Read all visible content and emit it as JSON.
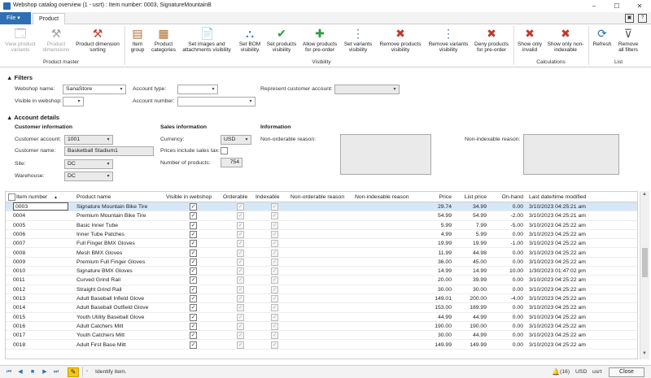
{
  "window": {
    "title": "Webshop catalog overview (1 - usrt) : Item number: 0003, SignatureMountainB",
    "minimize": "–",
    "maximize": "☐",
    "close": "✕"
  },
  "tabs": {
    "file": "File",
    "file_arrow": "▾",
    "product": "Product"
  },
  "ribbon": {
    "groups": {
      "product_master": "Product master",
      "visibility": "Visibility",
      "calculations": "Calculations",
      "list": "List"
    },
    "buttons": [
      {
        "label": "View product variants",
        "icon": "🗔",
        "disabled": true
      },
      {
        "label": "Product dimensions",
        "icon": "⚒",
        "disabled": true
      },
      {
        "label": "Product dimension sorting",
        "icon": "⚒",
        "disabled": false
      },
      {
        "label": "Item group",
        "icon": "▤",
        "disabled": false
      },
      {
        "label": "Product categories",
        "icon": "▦",
        "disabled": false
      },
      {
        "label": "Set images and attachments visibility",
        "icon": "📄",
        "disabled": false
      },
      {
        "label": "Set BOM visibility",
        "icon": "⛬",
        "disabled": false
      },
      {
        "label": "Set products visibility",
        "icon": "✔",
        "disabled": false
      },
      {
        "label": "Allow products for pre-order",
        "icon": "✚",
        "disabled": false
      },
      {
        "label": "Set variants visibility",
        "icon": "⋮",
        "disabled": false
      },
      {
        "label": "Remove products visibility",
        "icon": "✖",
        "disabled": false
      },
      {
        "label": "Remove variants visibility",
        "icon": "⋮",
        "disabled": false
      },
      {
        "label": "Deny products for pre-order",
        "icon": "✖",
        "disabled": false
      },
      {
        "label": "Show only invalid",
        "icon": "✖",
        "disabled": false
      },
      {
        "label": "Show only non-indexable",
        "icon": "✖",
        "disabled": false
      },
      {
        "label": "Refresh",
        "icon": "⟳",
        "disabled": false
      },
      {
        "label": "Remove all filters",
        "icon": "⊽",
        "disabled": false
      }
    ]
  },
  "filters": {
    "header": "Filters",
    "webshop_name_label": "Webshop name:",
    "webshop_name_value": "SanaStore",
    "visible_in_webshop_label": "Visible in webshop:",
    "visible_in_webshop_value": "",
    "account_type_label": "Account type:",
    "account_type_value": "",
    "account_number_label": "Account number:",
    "account_number_value": "",
    "represent_customer_label": "Represent customer account:",
    "represent_customer_value": ""
  },
  "account": {
    "header": "Account details",
    "customer_info_header": "Customer information",
    "customer_account_label": "Customer account:",
    "customer_account_value": "1001",
    "customer_name_label": "Customer name:",
    "customer_name_value": "Basketball Stadium1",
    "site_label": "Site:",
    "site_value": "DC",
    "warehouse_label": "Warehouse:",
    "warehouse_value": "DC",
    "sales_info_header": "Sales information",
    "currency_label": "Currency:",
    "currency_value": "USD",
    "prices_incl_tax_label": "Prices include sales tax:",
    "num_products_label": "Number of products:",
    "num_products_value": "754",
    "information_header": "Information",
    "non_orderable_label": "Non-orderable reason:",
    "non_indexable_label": "Non-indexable reason:"
  },
  "grid": {
    "columns": {
      "item_number": "Item number",
      "sort_arrow": "▲",
      "product_name": "Product name",
      "visible": "Visible in webshop",
      "orderable": "Orderable",
      "indexable": "Indexable",
      "non_orderable": "Non-orderable reason",
      "non_indexable": "Non-indexable reason",
      "price": "Price",
      "list_price": "List price",
      "on_hand": "On-hand",
      "last_modified": "Last date/time modified"
    },
    "rows": [
      {
        "item": "0003",
        "name": "Signature Mountain Bike Tire",
        "price": "29.74",
        "list": "34.99",
        "onhand": "0.00",
        "date": "3/10/2023 04:25:21 am"
      },
      {
        "item": "0004",
        "name": "Premium Mountain Bike Tire",
        "price": "54.99",
        "list": "54.99",
        "onhand": "-2.00",
        "date": "3/10/2023 04:25:21 am"
      },
      {
        "item": "0005",
        "name": "Basic Inner Tube",
        "price": "5.99",
        "list": "7.99",
        "onhand": "-5.00",
        "date": "3/10/2023 04:25:22 am"
      },
      {
        "item": "0006",
        "name": "Inner Tube Patches",
        "price": "4.99",
        "list": "5.99",
        "onhand": "0.00",
        "date": "3/10/2023 04:25:22 am"
      },
      {
        "item": "0007",
        "name": "Full Finger BMX Gloves",
        "price": "19.99",
        "list": "19.99",
        "onhand": "-1.00",
        "date": "3/10/2023 04:25:22 am"
      },
      {
        "item": "0008",
        "name": "Mesh BMX Gloves",
        "price": "11.99",
        "list": "44.98",
        "onhand": "0.00",
        "date": "3/10/2023 04:25:22 am"
      },
      {
        "item": "0009",
        "name": "Premium Full Finger Gloves",
        "price": "36.00",
        "list": "45.00",
        "onhand": "0.00",
        "date": "3/10/2023 04:25:22 am"
      },
      {
        "item": "0010",
        "name": "Signature BMX Gloves",
        "price": "14.99",
        "list": "14.99",
        "onhand": "10.00",
        "date": "1/30/2023 01:47:02 pm"
      },
      {
        "item": "0011",
        "name": "Curved Grind Rail",
        "price": "20.00",
        "list": "39.99",
        "onhand": "0.00",
        "date": "3/10/2023 04:25:22 am"
      },
      {
        "item": "0012",
        "name": "Straight Grind Rail",
        "price": "30.00",
        "list": "30.00",
        "onhand": "0.00",
        "date": "3/10/2023 04:25:22 am"
      },
      {
        "item": "0013",
        "name": "Adult Baseball Infield Glove",
        "price": "149.01",
        "list": "200.00",
        "onhand": "-4.00",
        "date": "3/10/2023 04:25:22 am"
      },
      {
        "item": "0014",
        "name": "Adult Baseball Outfield Glove",
        "price": "153.00",
        "list": "189.99",
        "onhand": "0.00",
        "date": "3/10/2023 04:25:22 am"
      },
      {
        "item": "0015",
        "name": "Youth Utility Baseball Glove",
        "price": "44.99",
        "list": "44.99",
        "onhand": "0.00",
        "date": "3/10/2023 04:25:22 am"
      },
      {
        "item": "0016",
        "name": "Adult Catchers Mitt",
        "price": "190.00",
        "list": "190.00",
        "onhand": "0.00",
        "date": "3/10/2023 04:25:22 am"
      },
      {
        "item": "0017",
        "name": "Youth Catchers Mitt",
        "price": "30.00",
        "list": "44.99",
        "onhand": "0.00",
        "date": "3/10/2023 04:25:22 am"
      },
      {
        "item": "0018",
        "name": "Adult First Base Mitt",
        "price": "149.99",
        "list": "149.99",
        "onhand": "0.00",
        "date": "3/10/2023 04:25:22 am"
      }
    ]
  },
  "status": {
    "message": "Identify item.",
    "notifications": "(16)",
    "currency": "USD",
    "company": "usrt",
    "close_label": "Close"
  },
  "colors": {
    "accent": "#2f6fb3",
    "selected_row": "#d6e8f7"
  }
}
